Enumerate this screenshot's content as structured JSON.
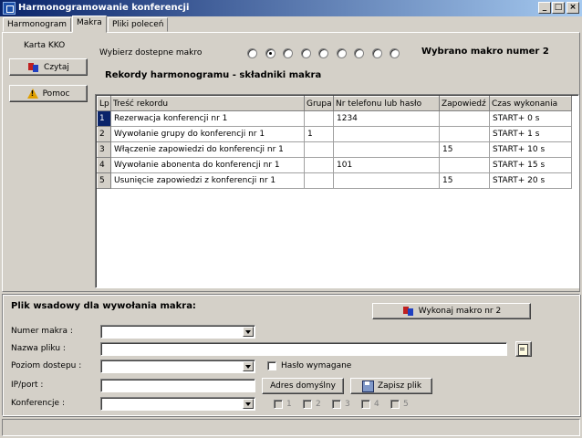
{
  "window": {
    "title": "Harmonogramowanie konferencji",
    "minimize": "_",
    "maximize": "□",
    "close": "×"
  },
  "tabs": [
    {
      "label": "Harmonogram"
    },
    {
      "label": "Makra"
    },
    {
      "label": "Pliki poleceń"
    }
  ],
  "active_tab": "Makra",
  "sidebar": {
    "title": "Karta KKO",
    "read_button": "Czytaj",
    "help_button": "Pomoc"
  },
  "macro_select": {
    "label": "Wybierz dostepne makro",
    "radio_count": 9,
    "selected_index": 1,
    "selected_text": "Wybrano makro numer 2"
  },
  "records": {
    "title": "Rekordy harmonogramu - składniki makra",
    "columns": [
      "Lp",
      "Treść rekordu",
      "Grupa",
      "Nr telefonu lub hasło",
      "Zapowiedź",
      "Czas wykonania"
    ],
    "rows": [
      [
        "1",
        "Rezerwacja konferencji nr 1",
        "",
        "1234",
        "",
        "START+ 0 s"
      ],
      [
        "2",
        "Wywołanie grupy do konferencji nr 1",
        "1",
        "",
        "",
        "START+ 1 s"
      ],
      [
        "3",
        "Włączenie zapowiedzi do konferencji nr 1",
        "",
        "",
        "15",
        "START+ 10 s"
      ],
      [
        "4",
        "Wywołanie abonenta do konferencji nr 1",
        "",
        "101",
        "",
        "START+ 15 s"
      ],
      [
        "5",
        "Usunięcie zapowiedzi z konferencji nr 1",
        "",
        "",
        "15",
        "START+ 20 s"
      ]
    ],
    "selected_row": 0
  },
  "batch": {
    "title": "Plik wsadowy dla wywołania makra:",
    "run_button": "Wykonaj makro nr 2",
    "macro_number_label": "Numer makra :",
    "macro_number_value": "",
    "file_name_label": "Nazwa pliku :",
    "file_name_value": "",
    "access_level_label": "Poziom dostepu :",
    "access_level_value": "",
    "password_required_label": "Hasło wymagane",
    "password_required": false,
    "ip_port_label": "IP/port :",
    "ip_port_value": "",
    "default_address_button": "Adres domyślny",
    "save_file_button": "Zapisz plik",
    "conferences_label": "Konferencje :",
    "conferences_value": "",
    "conference_checks": [
      "1",
      "2",
      "3",
      "4",
      "5"
    ]
  },
  "status": {
    "text": ""
  }
}
